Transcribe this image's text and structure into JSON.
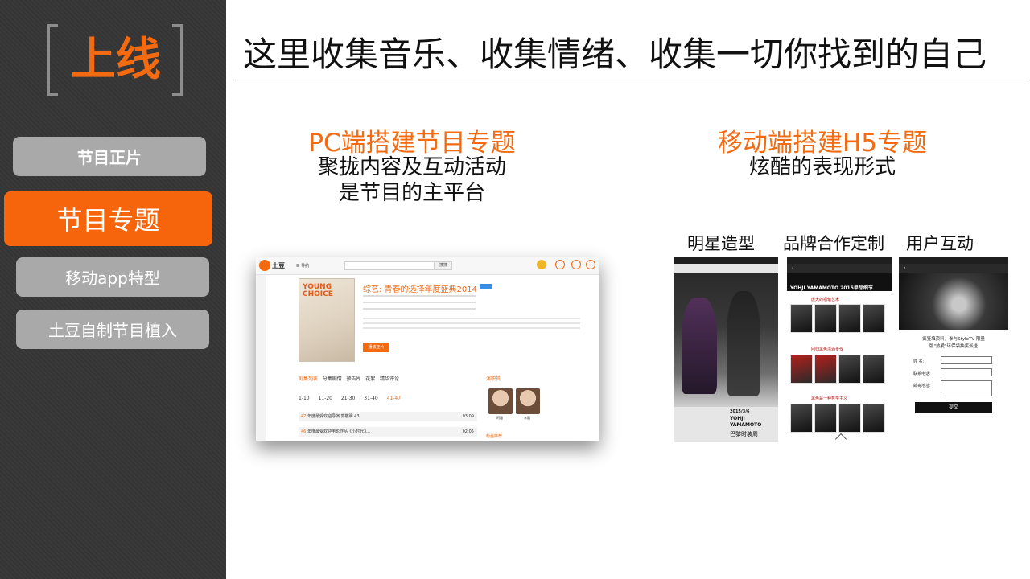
{
  "brand": {
    "text": "上线"
  },
  "nav": [
    {
      "label": "节目正片"
    },
    {
      "label": "节目专题"
    },
    {
      "label": "移动app特型"
    },
    {
      "label": "土豆自制节目植入"
    }
  ],
  "headline": "这里收集音乐、收集情绪、收集一切你找到的自己",
  "pc": {
    "title": "PC端搭建节目专题",
    "subtitle_1": "聚拢内容及互动活动",
    "subtitle_2": "是节目的主平台"
  },
  "mobile": {
    "title": "移动端搭建H5专题",
    "subtitle": "炫酷的表现形式",
    "labels": [
      "明星造型",
      "品牌合作定制",
      "用户互动"
    ]
  },
  "pc_screenshot": {
    "logo": "土豆",
    "nav": "☰ 导航",
    "search_button": "搜搜",
    "poster_text": "YOUNG CHOICE",
    "show_title": "综艺: 青春的选择年度盛典2014",
    "play_button": "播放正片",
    "tabs": [
      "剧集列表",
      "分集剧情",
      "预告片",
      "花絮",
      "精华评论"
    ],
    "episodes": [
      "1-10",
      "11-20",
      "21-30",
      "31-40",
      "41-47"
    ],
    "rows": [
      {
        "num": "47",
        "text": "年度最受欢迎导演 郭敬明 43",
        "dur": "03:09"
      },
      {
        "num": "46",
        "text": "年度最受欢迎电影作品《小时代3...",
        "dur": "02:05"
      }
    ],
    "cast_title": "演职员",
    "cast": [
      "阿雅",
      "李晨"
    ],
    "fans": "粉丝推荐"
  },
  "phone1": {
    "date": "2015/3/6",
    "brand_1": "YOHJI",
    "brand_2": "YAMAMOTO",
    "city": "巴黎时装周"
  },
  "phone2": {
    "title": "YOHJI YAMAMOTO 2015单品细节",
    "sections": [
      "庞大的褶皱艺术",
      "回归黑色漂酒步伐",
      "黑色是一种哲学主义"
    ]
  },
  "phone3": {
    "line1": "疯狂填资料，参与StyleTV 限量",
    "line2": "版\"热爱\"环保袋抽奖派送",
    "fields": [
      "姓  名:",
      "联系电话:",
      "邮寄地址:"
    ],
    "submit": "提交"
  },
  "colors": {
    "accent": "#f36a10",
    "panel": "#3a3a3a",
    "pill": "#a9a9a9"
  }
}
